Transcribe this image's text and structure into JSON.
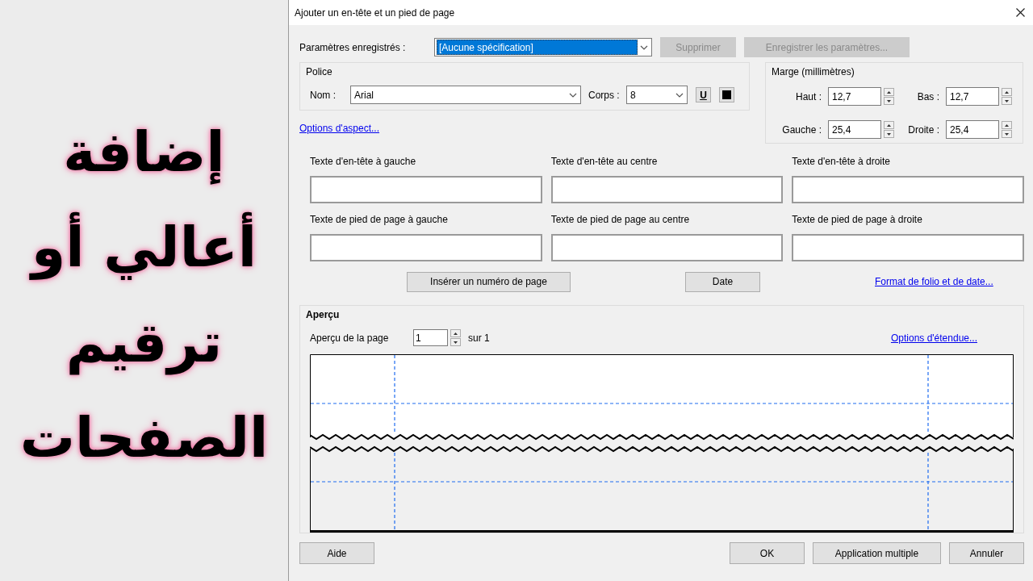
{
  "headline": [
    "إضافة",
    "أعالي أو",
    "ترقيم",
    "الصفحات"
  ],
  "dialog": {
    "title": "Ajouter un en-tête et un pied de page",
    "saved_settings": {
      "label": "Paramètres enregistrés :",
      "value": "[Aucune spécification]"
    },
    "top_buttons": [
      {
        "label": "Supprimer",
        "disabled": true
      },
      {
        "label": "Enregistrer les paramètres...",
        "disabled": true
      }
    ],
    "font": {
      "group": "Police",
      "name_label": "Nom :",
      "name_value": "Arial",
      "size_label": "Corps :",
      "size_value": "8",
      "underline_button": "U"
    },
    "appearance_link": "Options d'aspect...",
    "margin": {
      "group": "Marge (millimètres)",
      "fields": [
        {
          "label": "Haut :",
          "value": "12,7"
        },
        {
          "label": "Bas :",
          "value": "12,7"
        },
        {
          "label": "Gauche :",
          "value": "25,4"
        },
        {
          "label": "Droite :",
          "value": "25,4"
        }
      ]
    },
    "header_fields": [
      "Texte d'en-tête à gauche",
      "Texte d'en-tête au centre",
      "Texte d'en-tête à droite"
    ],
    "footer_fields": [
      "Texte de pied de page à gauche",
      "Texte de pied de page au centre",
      "Texte de pied de page à droite"
    ],
    "insert_page_number": "Insérer un numéro de page",
    "date_button": "Date",
    "format_link": "Format de folio et de date...",
    "preview": {
      "group": "Aperçu",
      "page_label": "Aperçu de la page",
      "page_value": "1",
      "of_label": "sur 1",
      "range_link": "Options d'étendue..."
    },
    "bottom_buttons": [
      {
        "label": "Aide"
      },
      {
        "label": "OK"
      },
      {
        "label": "Application multiple"
      },
      {
        "label": "Annuler"
      }
    ]
  }
}
